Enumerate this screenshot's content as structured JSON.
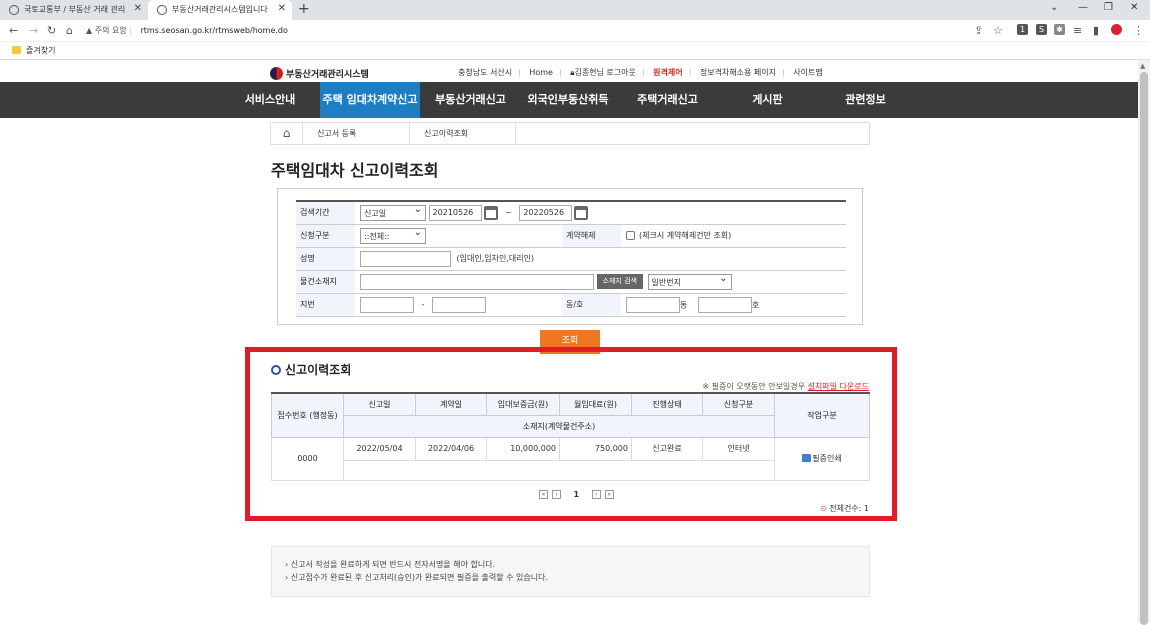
{
  "browser": {
    "tabs": [
      {
        "title": "국토교통부 / 부동산 거래 관리"
      },
      {
        "title": "부동산거래관리시스템입니다"
      }
    ],
    "security_label": "주의 요함",
    "url": "rtms.seosan.go.kr/rtmsweb/home.do",
    "bookmark": "즐겨찾기"
  },
  "header": {
    "logo_text": "부동산거래관리시스템",
    "util_links": [
      "충청남도 서산시",
      "Home",
      "김종현님 로그아웃",
      "원격제어",
      "정보격차해소용 페이지",
      "사이트맵"
    ]
  },
  "nav": {
    "items": [
      "서비스안내",
      "주택 임대차계약신고",
      "부동산거래신고",
      "외국인부동산취득",
      "주택거래신고",
      "게시판",
      "관련정보"
    ]
  },
  "breadcrumb": [
    "신고서 등록",
    "신고이력조회"
  ],
  "page_title": "주택임대차 신고이력조회",
  "search": {
    "period_label": "검색기간",
    "period_type": "신고일",
    "date_from": "20210526",
    "date_sep": "~",
    "date_to": "20220526",
    "apply_type_label": "신청구분",
    "apply_type_value": "::전체::",
    "cancel_label": "계약해제",
    "cancel_checkbox_text": "(체크시 계약해제건만 조회)",
    "name_label": "성명",
    "name_value": "",
    "name_hint": "(임대인,임차인,대리인)",
    "address_label": "물건소재지",
    "address_value": "",
    "address_button": "소재지 검색",
    "address_type": "일반번지",
    "lot_label": "지번",
    "lot_sep": "-",
    "dongho_label": "동/호",
    "dong_unit": "동",
    "ho_unit": "호",
    "submit_button": "조회"
  },
  "results": {
    "title": "신고이력조회",
    "note_prefix": "※ 필증이 오랫동안 안보일경우",
    "note_link": "설치파일 다운로드",
    "headers": {
      "receipt_no": "접수번호 (행정동)",
      "report_date": "신고일",
      "contract_date": "계약일",
      "deposit": "임대보증금(원)",
      "monthly_rent": "월임대료(원)",
      "status": "진행상태",
      "apply_type": "신청구분",
      "location": "소재지(계약물건주소)",
      "action": "작업구분"
    },
    "rows": [
      {
        "receipt_no": "0000",
        "report_date": "2022/05/04",
        "contract_date": "2022/04/06",
        "deposit": "10,000,000",
        "monthly_rent": "750,000",
        "status": "신고완료",
        "apply_type": "인터넷",
        "location": "",
        "action": "필증인쇄"
      }
    ],
    "pagination": {
      "current": "1"
    },
    "total_label": "전체건수: 1"
  },
  "notices": [
    "신고서 작성을 완료하게 되면 반드시 전자서명을 해야 합니다.",
    "신고접수가 완료된 후 신고처리(승인)가 완료되면 필증을 출력할 수 있습니다."
  ]
}
